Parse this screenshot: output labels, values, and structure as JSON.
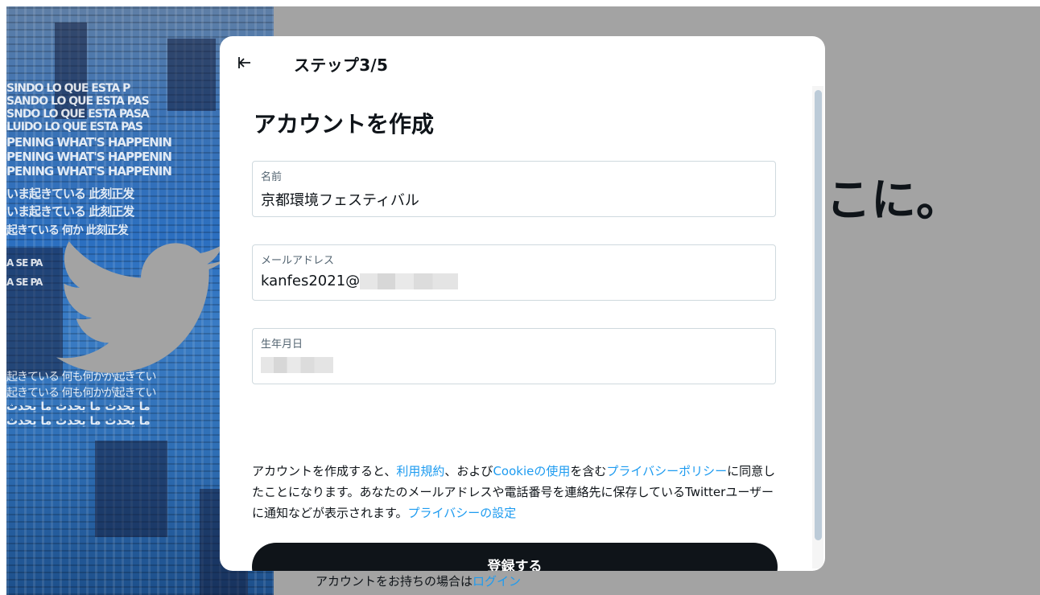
{
  "background": {
    "headline_fragment": "こに。",
    "login_prompt": "アカウントをお持ちの場合は",
    "login_link": "ログイン",
    "art_bands": [
      "SINDO LO QUE ESTA P",
      "SANDO LO QUE ESTA PAS",
      "SNDO LO QUE ESTA PASA",
      "LUIDO LO QUE ESTA PAS",
      "PENING WHAT'S HAPPENIN",
      "PENING WHAT'S HAPPENIN",
      "PENING WHAT'S HAPPENIN",
      "いま起きている 此刻正发",
      "いま起きている 此刻正发",
      "起きている 何か 此刻正发",
      "A SE PA",
      "A SE PA",
      "起きている 何も何かが起きてい",
      "起きている 何も何かが起きてい",
      "ما يحدث ما يحدث ما يحدث",
      "ما يحدث ما يحدث ما يحدث"
    ],
    "colors": {
      "art": "#2b6fc0",
      "overlay": "#a3a3a3",
      "bird": "#a3a3a3"
    }
  },
  "modal": {
    "step": "ステップ3/5",
    "back_icon": "arrow-left-bar-icon",
    "heading": "アカウントを作成",
    "fields": [
      {
        "label": "名前",
        "value": "京都環境フェスティバル"
      },
      {
        "label": "メールアドレス",
        "value": "kanfes2021@"
      },
      {
        "label": "生年月日",
        "value": ""
      }
    ],
    "terms": {
      "t1": "アカウントを作成すると、",
      "l1": "利用規約",
      "t2": "、および",
      "l2": "Cookieの使用",
      "t3": "を含む",
      "l3": "プライバシーポリシー",
      "t4": "に同意したことになります。あなたのメールアドレスや電話番号を連絡先に保存しているTwitterユーザーに通知などが表示されます。",
      "l4": "プライバシーの設定"
    },
    "submit_label": "登録する",
    "colors": {
      "link": "#1d9bf0",
      "button": "#0f1419",
      "border": "#cfd9de"
    }
  }
}
